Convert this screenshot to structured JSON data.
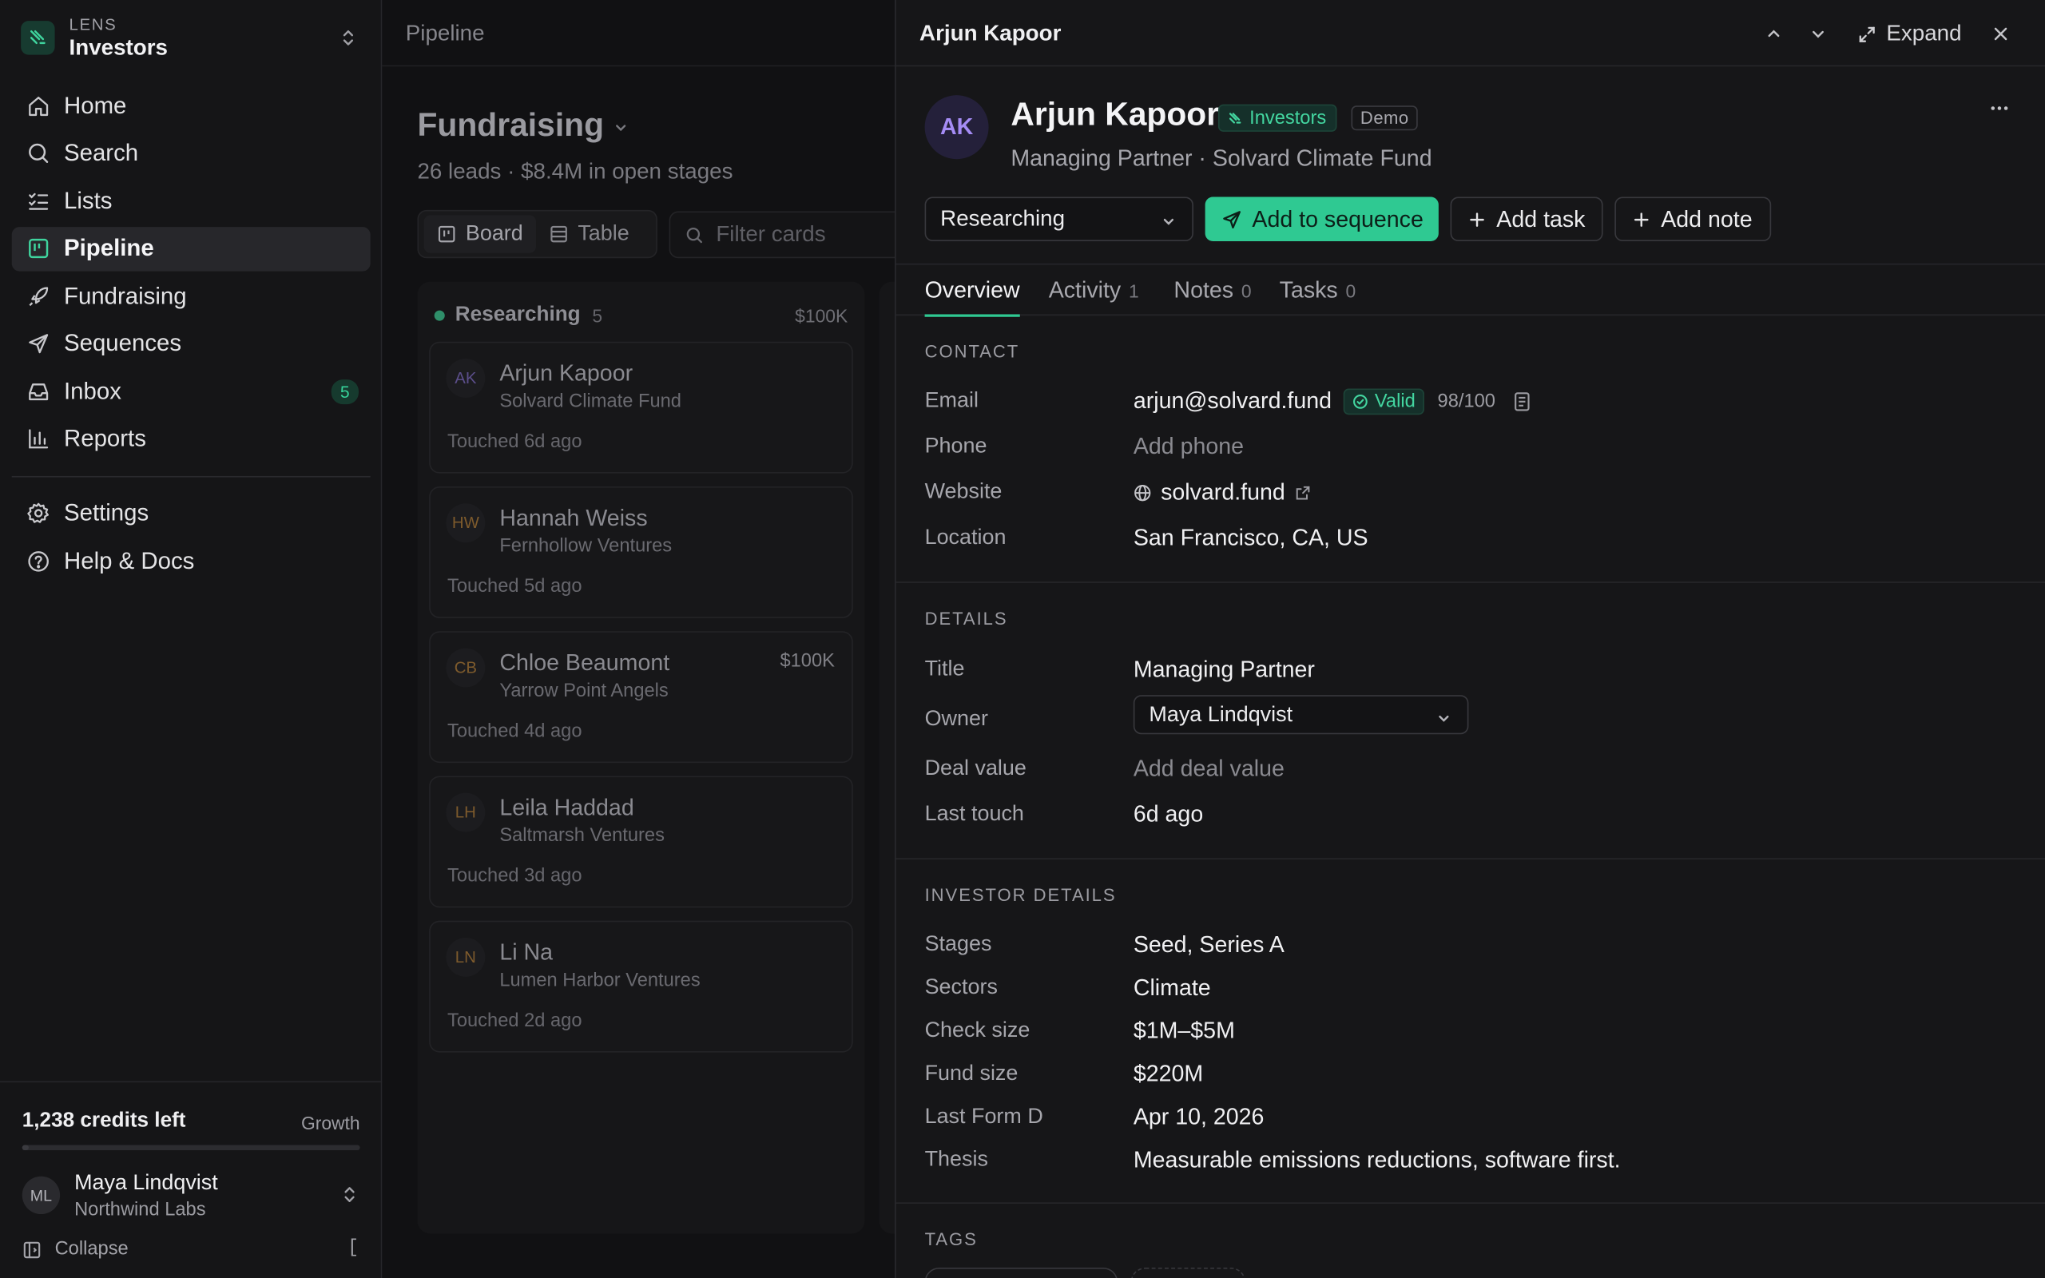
{
  "workspace": {
    "small": "LENS",
    "name": "Investors"
  },
  "nav": {
    "items": [
      {
        "label": "Home",
        "icon": "home-icon"
      },
      {
        "label": "Search",
        "icon": "search-icon"
      },
      {
        "label": "Lists",
        "icon": "list-icon"
      },
      {
        "label": "Pipeline",
        "icon": "kanban-icon",
        "active": true
      },
      {
        "label": "Fundraising",
        "icon": "rocket-icon"
      },
      {
        "label": "Sequences",
        "icon": "send-icon"
      },
      {
        "label": "Inbox",
        "icon": "inbox-icon",
        "badge": "5"
      },
      {
        "label": "Reports",
        "icon": "chart-icon"
      }
    ],
    "secondary": [
      {
        "label": "Settings",
        "icon": "gear-icon"
      },
      {
        "label": "Help & Docs",
        "icon": "help-icon"
      }
    ]
  },
  "account": {
    "credits": "1,238 credits left",
    "credit_fraction": 0.02,
    "plan": "Growth",
    "user_initials": "ML",
    "user_name": "Maya Lindqvist",
    "user_org": "Northwind Labs",
    "collapse_label": "Collapse",
    "collapse_shortcut": "["
  },
  "main": {
    "breadcrumb": "Pipeline",
    "title": "Fundraising",
    "subtitle": "26 leads · $8.4M in open stages",
    "view_board": "Board",
    "view_table": "Table",
    "filter_placeholder": "Filter cards"
  },
  "column": {
    "name": "Researching",
    "count": "5",
    "total": "$100K",
    "cards": [
      {
        "initials": "AK",
        "name": "Arjun Kapoor",
        "firm": "Solvard Climate Fund",
        "touched": "Touched 6d ago",
        "value": "",
        "color": "#5b4e8a"
      },
      {
        "initials": "HW",
        "name": "Hannah Weiss",
        "firm": "Fernhollow Ventures",
        "touched": "Touched 5d ago",
        "value": "",
        "color": "#7d5a2c"
      },
      {
        "initials": "CB",
        "name": "Chloe Beaumont",
        "firm": "Yarrow Point Angels",
        "touched": "Touched 4d ago",
        "value": "$100K",
        "color": "#7d5a2c"
      },
      {
        "initials": "LH",
        "name": "Leila Haddad",
        "firm": "Saltmarsh Ventures",
        "touched": "Touched 3d ago",
        "value": "",
        "color": "#7d5a2c"
      },
      {
        "initials": "LN",
        "name": "Li Na",
        "firm": "Lumen Harbor Ventures",
        "touched": "Touched 2d ago",
        "value": "",
        "color": "#7d5a2c"
      }
    ]
  },
  "panel": {
    "top_title": "Arjun Kapoor",
    "expand_label": "Expand",
    "initials": "AK",
    "name": "Arjun Kapoor",
    "list_pill": "Investors",
    "demo_pill": "Demo",
    "subtitle": "Managing Partner · Solvard Climate Fund",
    "stage": "Researching",
    "add_sequence": "Add to sequence",
    "add_task": "Add task",
    "add_note": "Add note",
    "tabs": [
      {
        "label": "Overview",
        "count": ""
      },
      {
        "label": "Activity",
        "count": "1"
      },
      {
        "label": "Notes",
        "count": "0"
      },
      {
        "label": "Tasks",
        "count": "0"
      }
    ],
    "contact": {
      "title": "CONTACT",
      "email_label": "Email",
      "email": "arjun@solvard.fund",
      "email_status": "Valid",
      "email_score": "98/100",
      "phone_label": "Phone",
      "phone": "Add phone",
      "website_label": "Website",
      "website": "solvard.fund",
      "location_label": "Location",
      "location": "San Francisco, CA, US"
    },
    "details": {
      "title": "DETAILS",
      "title_label": "Title",
      "title_value": "Managing Partner",
      "owner_label": "Owner",
      "owner": "Maya Lindqvist",
      "deal_label": "Deal value",
      "deal": "Add deal value",
      "touch_label": "Last touch",
      "touch": "6d ago"
    },
    "investor": {
      "title": "INVESTOR DETAILS",
      "stages_label": "Stages",
      "stages": "Seed, Series A",
      "sectors_label": "Sectors",
      "sectors": "Climate",
      "check_label": "Check size",
      "check": "$1M–$5M",
      "fund_label": "Fund size",
      "fund": "$220M",
      "formd_label": "Last Form D",
      "formd": "Apr 10, 2026",
      "thesis_label": "Thesis",
      "thesis": "Measurable emissions reductions, software first."
    },
    "tags_title": "TAGS"
  },
  "colors": {
    "accent": "#2fc992",
    "accent_text": "#43d6a0",
    "avatar_purple": "#a58cf5"
  }
}
